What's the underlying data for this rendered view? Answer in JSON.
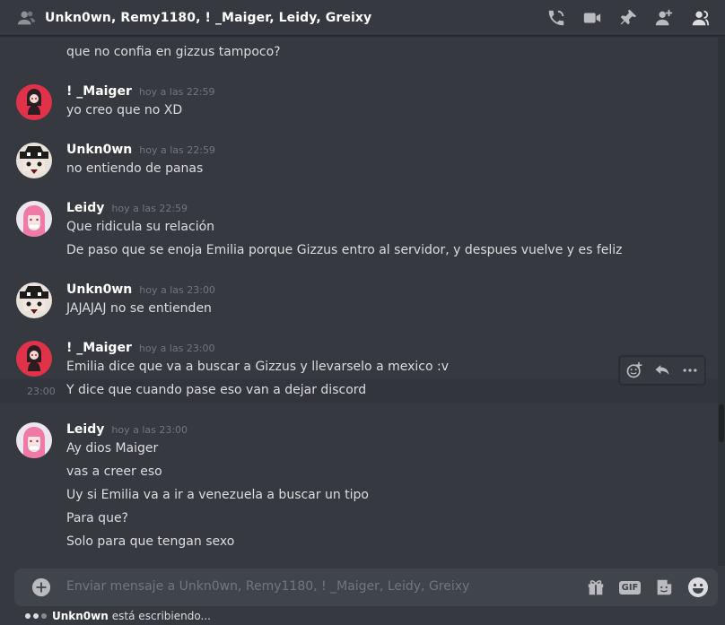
{
  "header": {
    "title": "Unkn0wn, Remy1180, ! _Maiger, Leidy, Greixy",
    "actions": [
      "call-icon",
      "video-icon",
      "pin-icon",
      "add-member-icon",
      "member-list-icon"
    ]
  },
  "messages": [
    {
      "continued": true,
      "lines": [
        "que no confia en gizzus tampoco?"
      ]
    },
    {
      "author": "! _Maiger",
      "time": "hoy a las 22:59",
      "avatar": "maiger-avatar",
      "lines": [
        "yo creo que no XD"
      ]
    },
    {
      "author": "Unkn0wn",
      "time": "hoy a las 22:59",
      "avatar": "unknown-avatar",
      "lines": [
        "no entiendo de panas"
      ]
    },
    {
      "author": "Leidy",
      "time": "hoy a las 22:59",
      "avatar": "leidy-avatar",
      "lines": [
        "Que ridicula su relación",
        "De paso que se enoja Emilia porque Gizzus entro al servidor, y despues vuelve y es feliz"
      ]
    },
    {
      "author": "Unkn0wn",
      "time": "hoy a las 23:00",
      "avatar": "unknown-avatar",
      "lines": [
        "JAJAJAJ no se entienden"
      ]
    },
    {
      "author": "! _Maiger",
      "time": "hoy a las 23:00",
      "avatar": "maiger-avatar",
      "lines": [
        "Emilia dice que va a buscar a Gizzus y llevarselo a mexico :v",
        "Y dice que cuando pase eso van a dejar discord"
      ],
      "hover_time": "23:00"
    },
    {
      "author": "Leidy",
      "time": "hoy a las 23:00",
      "avatar": "leidy-avatar",
      "lines": [
        "Ay dios Maiger",
        "vas a creer eso",
        "Uy si Emilia va a ir a venezuela a buscar un tipo",
        "Para que?",
        "Solo para que tengan sexo"
      ]
    }
  ],
  "message_toolbar": [
    "add-reaction-icon",
    "reply-icon",
    "more-icon"
  ],
  "composer": {
    "placeholder": "Enviar mensaje a Unkn0wn, Remy1180, ! _Maiger, Leidy, Greixy",
    "gif_label": "GIF"
  },
  "typing": {
    "user": "Unkn0wn",
    "text": "está escribiendo..."
  },
  "colors": {
    "background": "#36393f",
    "composer": "#40444b",
    "text": "#dcddde",
    "muted": "#72767d"
  }
}
